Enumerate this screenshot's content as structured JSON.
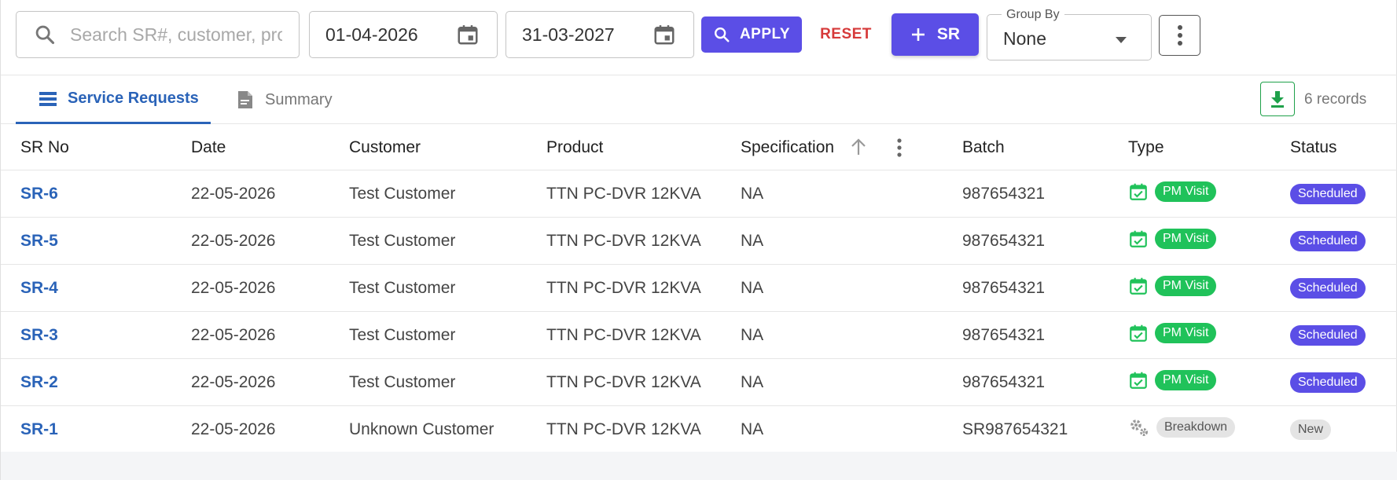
{
  "search": {
    "placeholder": "Search SR#, customer, product"
  },
  "filters": {
    "start_date": "01-04-2026",
    "end_date": "31-03-2027"
  },
  "toolbar": {
    "apply_label": "APPLY",
    "reset_label": "RESET",
    "add_label": "SR"
  },
  "group_by": {
    "legend": "Group By",
    "value": "None"
  },
  "tabs": [
    {
      "label": "Service Requests",
      "active": true
    },
    {
      "label": "Summary",
      "active": false
    }
  ],
  "records_label": "6 records",
  "table": {
    "headers": [
      "SR No",
      "Date",
      "Customer",
      "Product",
      "Specification",
      "Batch",
      "Type",
      "Status"
    ],
    "rows": [
      {
        "sr": "SR-6",
        "date": "22-05-2026",
        "customer": "Test Customer",
        "product": "TTN PC-DVR 12KVA",
        "spec": "NA",
        "batch": "987654321",
        "type": "PM Visit",
        "status": "Scheduled"
      },
      {
        "sr": "SR-5",
        "date": "22-05-2026",
        "customer": "Test Customer",
        "product": "TTN PC-DVR 12KVA",
        "spec": "NA",
        "batch": "987654321",
        "type": "PM Visit",
        "status": "Scheduled"
      },
      {
        "sr": "SR-4",
        "date": "22-05-2026",
        "customer": "Test Customer",
        "product": "TTN PC-DVR 12KVA",
        "spec": "NA",
        "batch": "987654321",
        "type": "PM Visit",
        "status": "Scheduled"
      },
      {
        "sr": "SR-3",
        "date": "22-05-2026",
        "customer": "Test Customer",
        "product": "TTN PC-DVR 12KVA",
        "spec": "NA",
        "batch": "987654321",
        "type": "PM Visit",
        "status": "Scheduled"
      },
      {
        "sr": "SR-2",
        "date": "22-05-2026",
        "customer": "Test Customer",
        "product": "TTN PC-DVR 12KVA",
        "spec": "NA",
        "batch": "987654321",
        "type": "PM Visit",
        "status": "Scheduled"
      },
      {
        "sr": "SR-1",
        "date": "22-05-2026",
        "customer": "Unknown Customer",
        "product": "TTN PC-DVR 12KVA",
        "spec": "NA",
        "batch": "SR987654321",
        "type": "Breakdown",
        "status": "New"
      }
    ]
  },
  "colors": {
    "primary": "#5b4ee6",
    "link": "#2a63b8",
    "reset": "#d63a3a",
    "pm_visit": "#20c25a",
    "download": "#1fa14a"
  }
}
